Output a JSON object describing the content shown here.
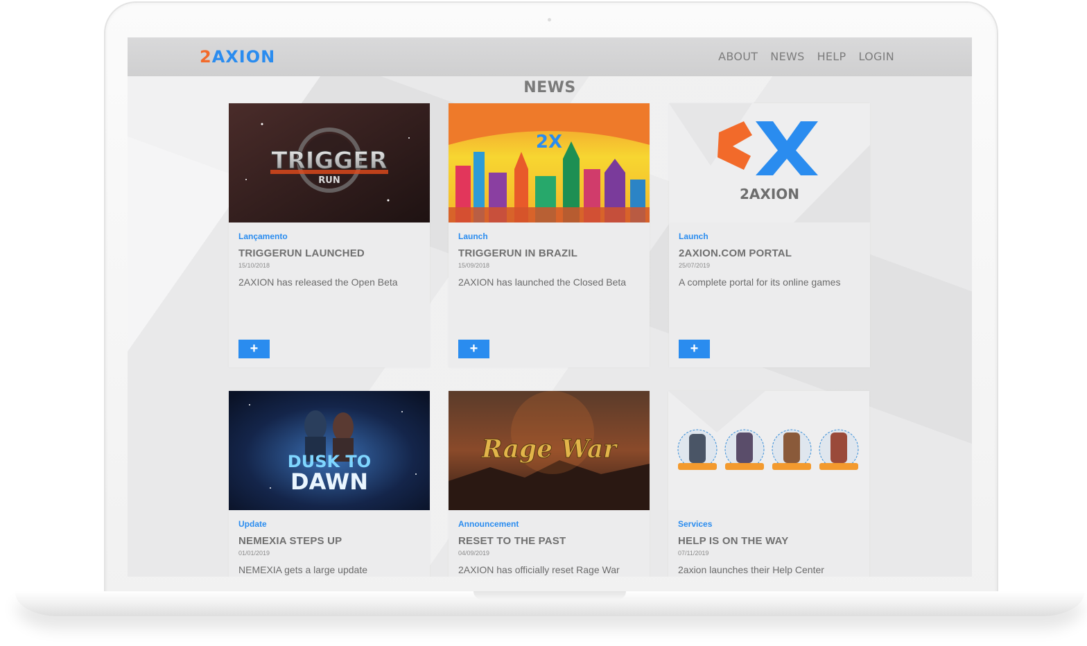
{
  "brand": {
    "logo_part1": "2",
    "logo_part2": "AXION"
  },
  "nav": {
    "about": "ABOUT",
    "news": "NEWS",
    "help": "HELP",
    "login": "LOGIN"
  },
  "page_title": "NEWS",
  "thumb_texts": {
    "trigger_main": "TRIGGER",
    "trigger_sub": "RUN",
    "portal_logo": "2AXION",
    "dusk_line1": "DUSK TO",
    "dusk_line2": "DAWN",
    "ragewar": "Rage War"
  },
  "cards": [
    {
      "category": "Lançamento",
      "title": "TRIGGERUN LAUNCHED",
      "date": "15/10/2018",
      "description": "2AXION has released the Open Beta",
      "more_label": "+"
    },
    {
      "category": "Launch",
      "title": "TRIGGERUN IN BRAZIL",
      "date": "15/09/2018",
      "description": "2AXION has launched the Closed Beta",
      "more_label": "+"
    },
    {
      "category": "Launch",
      "title": "2AXION.COM PORTAL",
      "date": "25/07/2019",
      "description": "A complete portal for its online games",
      "more_label": "+"
    },
    {
      "category": "Update",
      "title": "NEMEXIA STEPS UP",
      "date": "01/01/2019",
      "description": "NEMEXIA gets a large update"
    },
    {
      "category": "Announcement",
      "title": "RESET TO THE PAST",
      "date": "04/09/2019",
      "description": "2AXION has officially reset Rage War"
    },
    {
      "category": "Services",
      "title": "HELP IS ON THE WAY",
      "date": "07/11/2019",
      "description": "2axion launches their Help Center"
    }
  ],
  "colors": {
    "accent": "#2a8cef",
    "logo_orange": "#f26a2a",
    "navbar": "#d4d4d5"
  }
}
